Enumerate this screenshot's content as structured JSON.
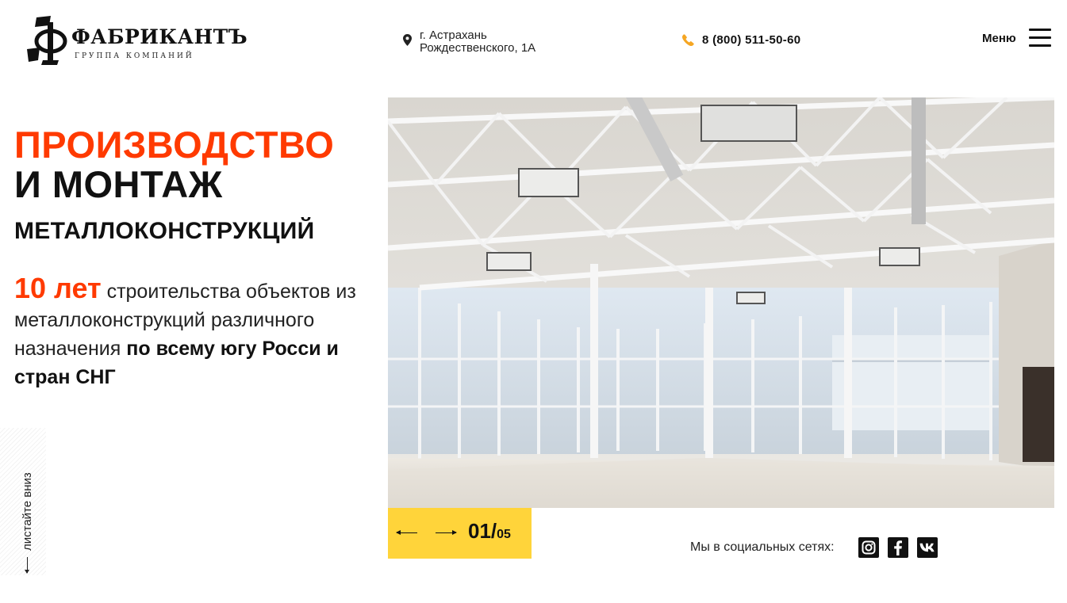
{
  "header": {
    "logo": {
      "name": "ФАБРИКАНТЪ",
      "subtitle": "ГРУППА КОМПАНИЙ"
    },
    "address": {
      "line1": "г. Астрахань",
      "line2": "Рождественского, 1А",
      "icon": "location-pin-icon"
    },
    "phone": {
      "number": "8 (800) 511-50-60",
      "icon": "phone-icon"
    },
    "menu": {
      "label": "Меню",
      "icon": "hamburger-icon"
    }
  },
  "hero": {
    "title_line1": "ПРОИЗВОДСТВО",
    "title_line2": "И МОНТАЖ",
    "title_line3": "МЕТАЛЛОКОНСТРУКЦИЙ",
    "highlight": "10 лет",
    "desc_part1": " строительства объектов из металлоконструкций различного назначения ",
    "desc_bold": "по всему югу Росси и стран СНГ"
  },
  "scroll_hint": "листайте вниз",
  "slider": {
    "current": "01/",
    "total": "05"
  },
  "social": {
    "label": "Мы в социальных сетях:",
    "networks": [
      "instagram-icon",
      "facebook-icon",
      "vk-icon"
    ]
  },
  "colors": {
    "accent": "#ff3a00",
    "slider_bg": "#ffd43a",
    "phone_icon": "#f5a623"
  }
}
